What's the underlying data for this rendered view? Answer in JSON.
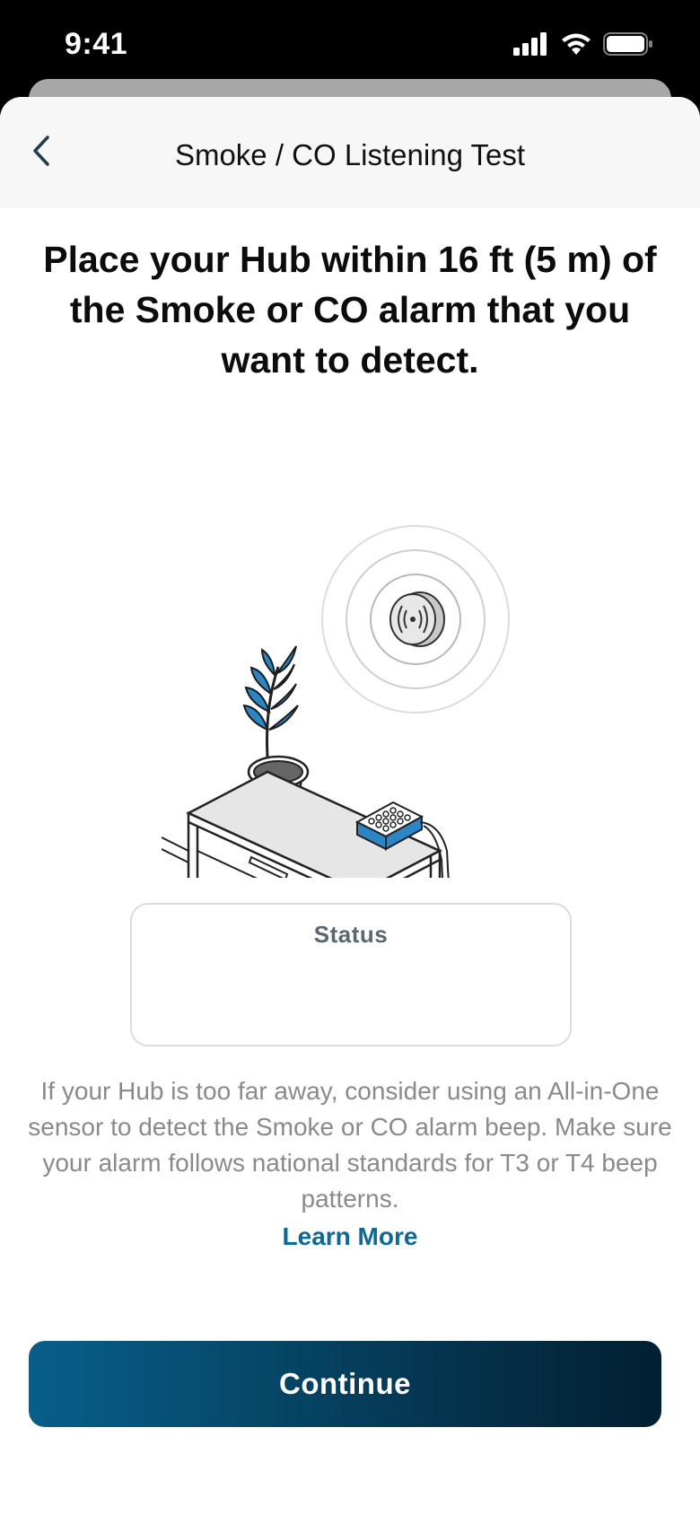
{
  "status_bar": {
    "time": "9:41",
    "icons": [
      "cellular-signal-icon",
      "wifi-icon",
      "battery-icon"
    ]
  },
  "nav": {
    "back_icon": "chevron-left-icon",
    "title": "Smoke / CO Listening Test"
  },
  "headline": "Place your Hub within 16 ft (5 m) of the Smoke or CO alarm that you want to detect.",
  "illustration": {
    "elements": [
      "smoke-alarm",
      "sound-waves",
      "plant",
      "table",
      "hub-device"
    ],
    "accent_color": "#2a86c4"
  },
  "status": {
    "label": "Status",
    "value": ""
  },
  "help_text": "If your Hub is too far away, consider using an All-in-One sensor to detect the Smoke or CO alarm beep. Make sure your alarm follows national standards for T3 or T4 beep patterns.",
  "learn_more": "Learn More",
  "continue_button": "Continue",
  "colors": {
    "primary": "#075f8a",
    "link": "#0b6a99",
    "muted_text": "#8a8a8a"
  }
}
